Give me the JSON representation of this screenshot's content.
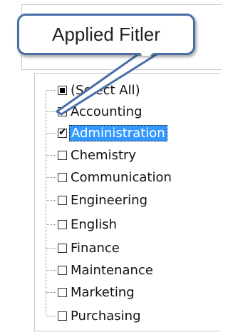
{
  "callout": {
    "text": "Applied Fitler",
    "border_color": "#4a6fa8"
  },
  "filter_list": {
    "items": [
      {
        "label": "(Select All)",
        "state": "partial"
      },
      {
        "label": "Accounting",
        "state": "checked"
      },
      {
        "label": "Administration",
        "state": "checked",
        "selected": true
      },
      {
        "label": "Chemistry",
        "state": "unchecked"
      },
      {
        "label": "Communication",
        "state": "unchecked"
      },
      {
        "label": "Engineering",
        "state": "unchecked"
      },
      {
        "label": "English",
        "state": "unchecked"
      },
      {
        "label": "Finance",
        "state": "unchecked"
      },
      {
        "label": "Maintenance",
        "state": "unchecked"
      },
      {
        "label": "Marketing",
        "state": "unchecked"
      },
      {
        "label": "Purchasing",
        "state": "unchecked"
      }
    ],
    "selection_color": "#3399ff"
  }
}
